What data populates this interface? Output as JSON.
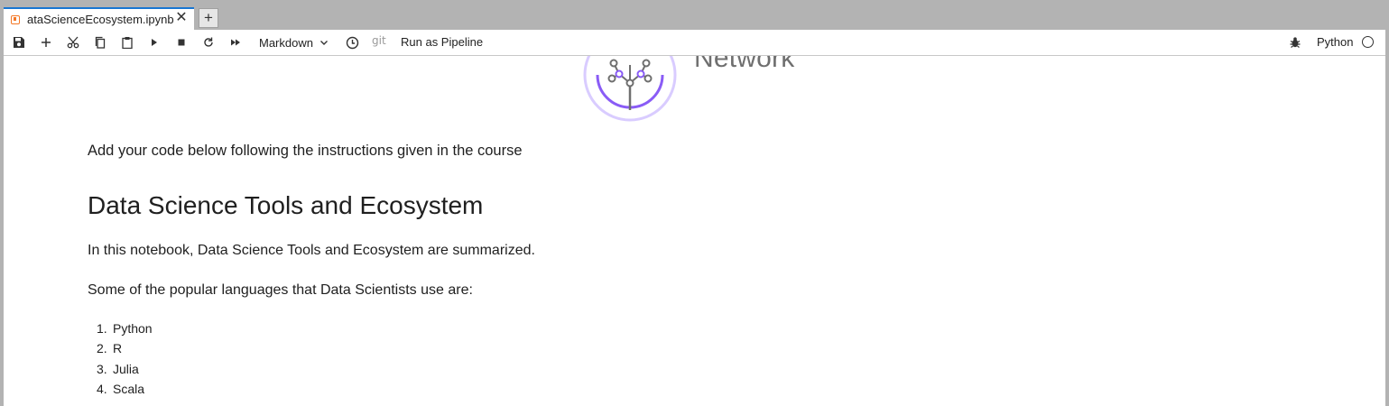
{
  "tab": {
    "title": "ataScienceEcosystem.ipynb",
    "close": "✕",
    "add": "+"
  },
  "toolbar": {
    "cell_type": "Markdown",
    "git": "git",
    "run_pipeline": "Run as Pipeline",
    "kernel_name": "Python"
  },
  "notebook": {
    "logo_word": "Network",
    "intro": "Add your code below following the instructions given in the course",
    "heading": "Data Science Tools and Ecosystem",
    "summary": "In this notebook, Data Science Tools and Ecosystem are summarized.",
    "languages_intro": "Some of the popular languages that Data Scientists use are:",
    "languages": [
      {
        "num": "1.",
        "name": "Python"
      },
      {
        "num": "2.",
        "name": "R"
      },
      {
        "num": "3.",
        "name": "Julia"
      },
      {
        "num": "4.",
        "name": "Scala"
      }
    ]
  },
  "colors": {
    "accent_tab": "#1976d2",
    "notebook_icon": "#f37726",
    "logo_purple": "#8a5cf6"
  }
}
